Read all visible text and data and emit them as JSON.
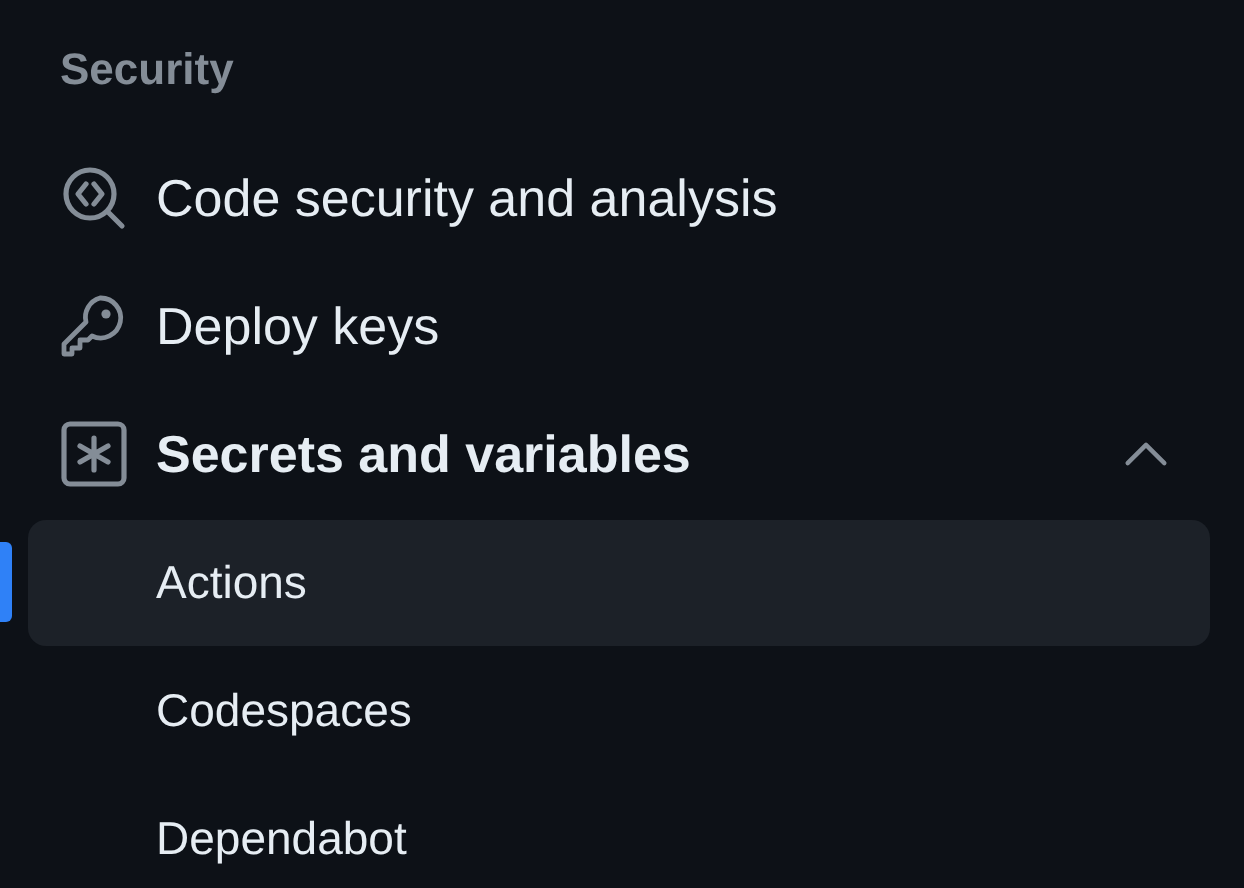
{
  "section_heading": "Security",
  "items": [
    {
      "kind": "link",
      "label": "Code security and analysis"
    },
    {
      "kind": "link",
      "label": "Deploy keys"
    },
    {
      "kind": "group",
      "label": "Secrets and variables",
      "expanded": true,
      "children": [
        {
          "label": "Actions",
          "selected": true
        },
        {
          "label": "Codespaces",
          "selected": false
        },
        {
          "label": "Dependabot",
          "selected": false
        }
      ]
    }
  ]
}
